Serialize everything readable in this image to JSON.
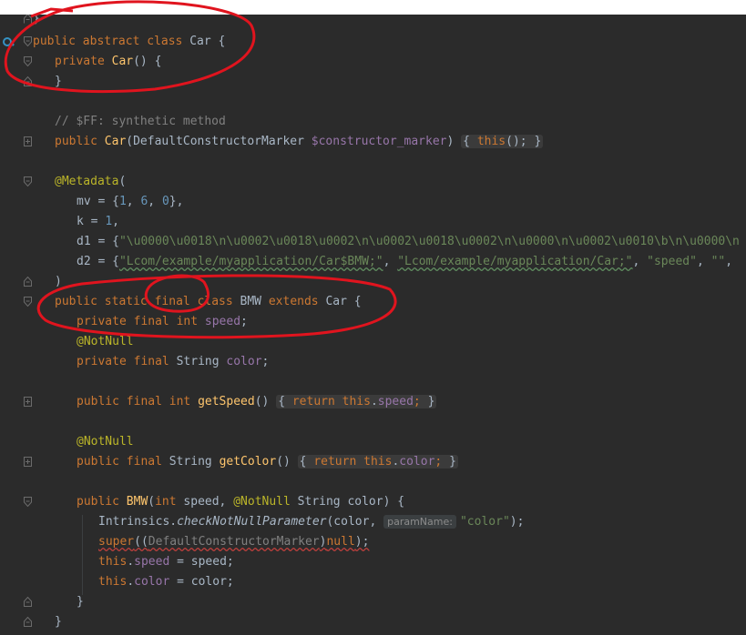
{
  "editor": {
    "lines": {
      "l0": {
        "brace": "}"
      },
      "l1": {
        "kw1": "public",
        "kw2": "abstract",
        "kw3": "class",
        "name": "Car",
        "rest": " {"
      },
      "l2": {
        "kw": "private",
        "fn": "Car",
        "rest": "() {"
      },
      "l3": {
        "brace": "}"
      },
      "l5": {
        "comment": "// $FF: synthetic method"
      },
      "l6": {
        "kw": "public",
        "fn": "Car",
        "p1": "(DefaultConstructorMarker ",
        "param": "$constructor_marker",
        "p2": ") ",
        "fold_open": "{",
        "body_kw": "this",
        "body_rest": "();",
        "fold_close": "}"
      },
      "l8": {
        "ann": "@Metadata",
        "rest": "("
      },
      "l9": {
        "key": "mv",
        "eq": " = {",
        "n1": "1",
        "c1": ", ",
        "n2": "6",
        "c2": ", ",
        "n3": "0",
        "end": "},"
      },
      "l10": {
        "key": "k",
        "eq": " = ",
        "n": "1",
        "end": ","
      },
      "l11": {
        "key": "d1",
        "eq": " = {",
        "str": "\"\\u0000\\u0018\\n\\u0002\\u0018\\u0002\\n\\u0002\\u0018\\u0002\\n\\u0000\\n\\u0002\\u0010\\b\\n\\u0000\\n"
      },
      "l12": {
        "key": "d2",
        "eq": " = {",
        "s1": "\"Lcom/example/myapplication/Car$BMW;\"",
        "c1": ", ",
        "s2": "\"Lcom/example/myapplication/Car;\"",
        "c2": ", ",
        "s3": "\"speed\"",
        "c3": ", ",
        "s4": "\"\"",
        "c4": ", "
      },
      "l13": {
        "brace": ")"
      },
      "l14": {
        "kw1": "public",
        "kw2": "static",
        "kw3": "final",
        "kw4": "class",
        "name": "BMW",
        "kw5": "extends",
        "parent": "Car",
        "rest": " {"
      },
      "l15": {
        "kw1": "private",
        "kw2": "final",
        "kw3": "int",
        "field": "speed",
        "end": ";"
      },
      "l16": {
        "ann": "@NotNull"
      },
      "l17": {
        "kw1": "private",
        "kw2": "final",
        "type": "String",
        "field": "color",
        "end": ";"
      },
      "l19": {
        "kw1": "public",
        "kw2": "final",
        "kw3": "int",
        "fn": "getSpeed",
        "p": "() ",
        "fold_open": "{",
        "body_kw": "return",
        "body_this": "this",
        "dot": ".",
        "field": "speed",
        "semi": ";",
        "fold_close": "}"
      },
      "l21": {
        "ann": "@NotNull"
      },
      "l22": {
        "kw1": "public",
        "kw2": "final",
        "type": "String",
        "fn": "getColor",
        "p": "() ",
        "fold_open": "{",
        "body_kw": "return",
        "body_this": "this",
        "dot": ".",
        "field": "color",
        "semi": ";",
        "fold_close": "}"
      },
      "l24": {
        "kw1": "public",
        "fn": "BMW",
        "p1": "(",
        "kw2": "int",
        "p2": " speed, ",
        "ann": "@NotNull",
        "p3": " String color) {"
      },
      "l25": {
        "cls": "Intrinsics",
        "dot": ".",
        "method": "checkNotNullParameter",
        "p1": "(color, ",
        "hint": "paramName:",
        "str": "\"color\"",
        "end": ");"
      },
      "l26": {
        "kw": "super",
        "p1": "((",
        "cast": "DefaultConstructorMarker",
        "p2": ")",
        "kw2": "null",
        "end": ");"
      },
      "l27": {
        "kw": "this",
        "dot": ".",
        "field": "speed",
        "rest": " = speed;"
      },
      "l28": {
        "kw": "this",
        "dot": ".",
        "field": "color",
        "rest": " = color;"
      },
      "l29": {
        "brace": "}"
      },
      "l30": {
        "brace": "}"
      }
    }
  },
  "colors": {
    "background": "#2b2b2b",
    "keyword": "#cc7832",
    "function": "#ffc66d",
    "annotation": "#bbb529",
    "number": "#6897bb",
    "string": "#6a8759",
    "comment": "#808080",
    "field": "#9876aa",
    "text": "#a9b7c6",
    "scribble": "#e0141e"
  },
  "icons": {
    "gutter": "implementation-marker-icon",
    "fold": "fold-toggle-icon"
  }
}
